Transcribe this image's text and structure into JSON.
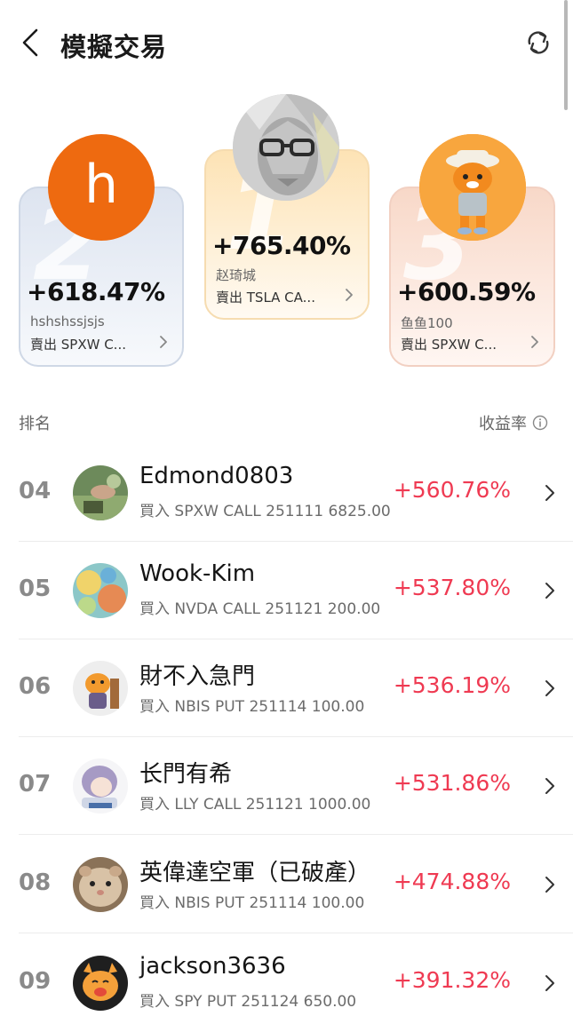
{
  "header": {
    "title": "模擬交易"
  },
  "podium": [
    {
      "rank": "2",
      "initial": "h",
      "percent": "+618.47%",
      "name": "hshshssjsjs",
      "trade": "賣出 SPXW C..."
    },
    {
      "rank": "1",
      "percent": "+765.40%",
      "name": "赵琦城",
      "trade": "賣出 TSLA CA..."
    },
    {
      "rank": "3",
      "percent": "+600.59%",
      "name": "鱼鱼100",
      "trade": "賣出 SPXW C..."
    }
  ],
  "list_header": {
    "left": "排名",
    "right": "收益率"
  },
  "rows": [
    {
      "rank": "04",
      "name": "Edmond0803",
      "trade": "買入 SPXW CALL 251111 6825.00",
      "percent": "+560.76%"
    },
    {
      "rank": "05",
      "name": "Wook-Kim",
      "trade": "買入 NVDA CALL 251121 200.00",
      "percent": "+537.80%"
    },
    {
      "rank": "06",
      "name": "財不入急門",
      "trade": "買入 NBIS PUT 251114 100.00",
      "percent": "+536.19%"
    },
    {
      "rank": "07",
      "name": "长門有希",
      "trade": "買入 LLY CALL 251121 1000.00",
      "percent": "+531.86%"
    },
    {
      "rank": "08",
      "name": "英偉達空軍（已破產）",
      "trade": "買入 NBIS PUT 251114 100.00",
      "percent": "+474.88%"
    },
    {
      "rank": "09",
      "name": "jackson3636",
      "trade": "買入 SPY PUT 251124 650.00",
      "percent": "+391.32%"
    }
  ],
  "colors": {
    "positive": "#ef3a52",
    "accent_orange": "#ee6a10"
  },
  "icons": [
    "back-arrow-icon",
    "refresh-icon",
    "chevron-right-icon",
    "info-icon"
  ]
}
